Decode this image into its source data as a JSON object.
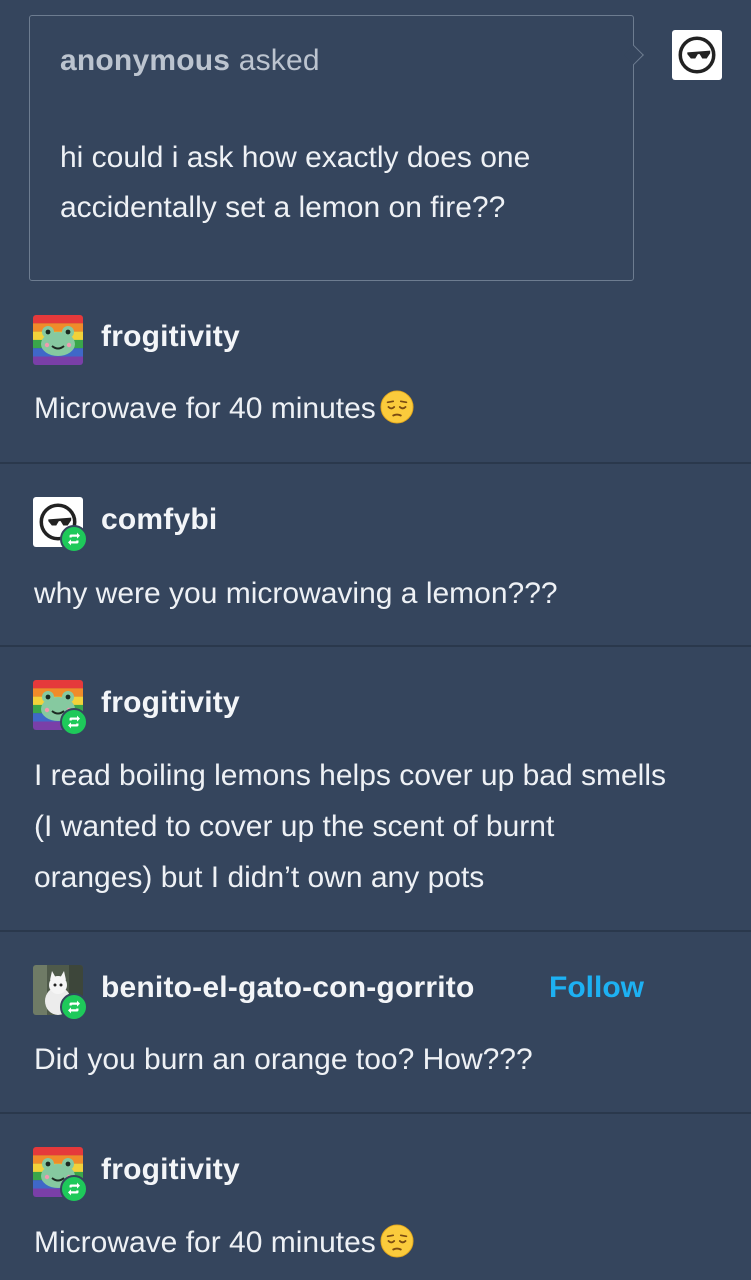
{
  "ask": {
    "asker": "anonymous",
    "verb": "asked",
    "question": "hi could i ask how exactly does one accidentally set a lemon on fire??",
    "recipient_avatar_icon": "sunglasses-avatar-icon"
  },
  "posts": [
    {
      "username": "frogitivity",
      "avatar_icon": "rainbow-frog-avatar-icon",
      "reblog_badge": false,
      "text": "Microwave for 40 minutes",
      "emoji_icon": "pensive-face-icon"
    },
    {
      "username": "comfybi",
      "avatar_icon": "sunglasses-avatar-icon",
      "reblog_badge": true,
      "text": "why were you microwaving a lemon???"
    },
    {
      "username": "frogitivity",
      "avatar_icon": "rainbow-frog-avatar-icon",
      "reblog_badge": true,
      "text": "I read boiling lemons helps cover up bad smells (I wanted to cover up the scent of burnt oranges) but I didn’t own any pots"
    },
    {
      "username": "benito-el-gato-con-gorrito",
      "avatar_icon": "cat-photo-avatar-icon",
      "reblog_badge": true,
      "follow_label": "Follow",
      "text": "Did you burn an orange too? How???"
    },
    {
      "username": "frogitivity",
      "avatar_icon": "rainbow-frog-avatar-icon",
      "reblog_badge": true,
      "text": "Microwave for 40 minutes",
      "emoji_icon": "pensive-face-icon"
    }
  ],
  "colors": {
    "background": "#35455d",
    "divider": "#2a384c",
    "reblog_green": "#1ec95a",
    "follow_blue": "#1db1f3"
  }
}
